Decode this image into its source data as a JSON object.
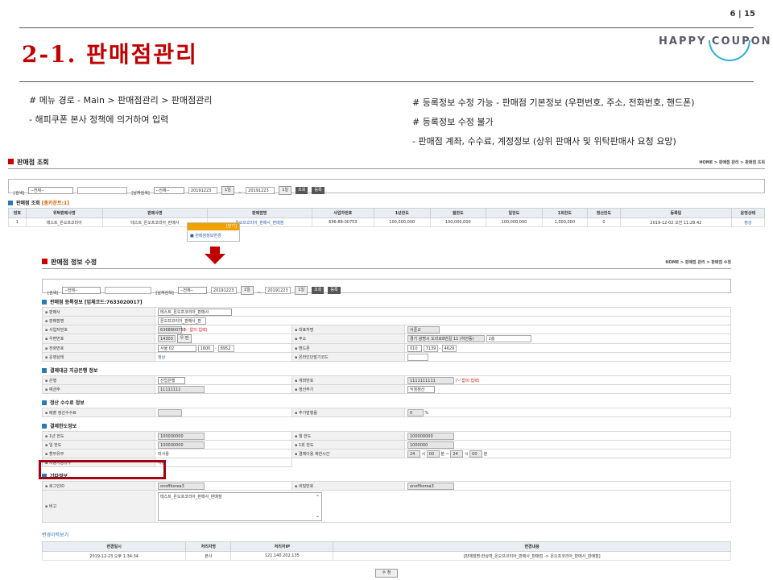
{
  "page_number": "6 | 15",
  "title": "2-1. 판매점관리",
  "logo": "HAPPY COUPON",
  "notes_left": [
    "# 메뉴 경로 - Main > 판매점관리 > 판매점관리",
    "- 해피쿠폰 본사 정책에 의거하여 입력"
  ],
  "notes_right": [
    "# 등록정보 수정 가능 - 판매점 기본정보 (우편번호, 주소, 전화번호, 핸드폰)",
    "# 등록정보 수정 불가",
    "- 판매점 계좌, 수수료, 계정정보 (상위 판매사 및 위탁판매사 요청 요망)"
  ],
  "list_screen": {
    "title": "판매점 조회",
    "breadcrumb": "HOME > 판매점 관리 > 판매점 조회",
    "search": {
      "label": "[검색]",
      "select": "--전체--",
      "date_label": "[날짜검색]",
      "date_select": "--전체--",
      "date_from": "20191223",
      "date_to": "20191223",
      "day": "1일",
      "sep": "~",
      "search_btn": "조회",
      "reg_btn": "등록"
    },
    "result_label": "판매점 조회",
    "result_count": "[총카운트:1]",
    "columns": [
      "번호",
      "위탁판매사명",
      "판매사명",
      "판매점명",
      "사업자번호",
      "1년한도",
      "월한도",
      "일한도",
      "1회한도",
      "정산한도",
      "등록일",
      "운영상태"
    ],
    "rows": [
      [
        "1",
        "테스트_온오프코리아",
        "테스트_온오프코리아_판매사",
        "온오프코리아_판매사_판매점",
        "636-88-00753",
        "100,000,000",
        "100,000,000",
        "100,000,000",
        "1,000,000",
        "0",
        "2019-12-02 오전 11:28:42",
        "정상"
      ]
    ],
    "popup_close": "[닫기]",
    "popup_item": "판매점정보변경"
  },
  "edit_screen": {
    "title": "판매점 정보 수정",
    "breadcrumb": "HOME > 판매점 관리 > 판매점 수정",
    "search": {
      "label": "[검색]",
      "select": "--전체--",
      "date_label": "[날짜검색]",
      "date_select": "--전체--",
      "date_from": "20191223",
      "date_to": "20191223",
      "day": "1일",
      "sep": "~",
      "search_btn": "조회",
      "reg_btn": "등록"
    },
    "reg_title": "판매점 등록정보 [업체코드:7633020017]",
    "reg": {
      "seller_label": "판매사",
      "seller_value": "테스트_온오프코리아_판매사",
      "store_label": "판매점명",
      "store_value": "온오프코리아_판매사_판",
      "biz_label": "사업자번호",
      "biz_value": "6368800753",
      "biz_note": "('-' 없이 입력)",
      "ceo_label": "대표자명",
      "ceo_value": "서준교",
      "zip_label": "우편번호",
      "zip_value": "14303",
      "zip_btn": "우 편",
      "addr_label": "주소",
      "addr_value": "경기 광명시 오리로8번길 11 (하안동)",
      "addr_detail": "2층",
      "tel_label": "전화번호",
      "tel_area": "서울 02",
      "tel_mid": "1600",
      "tel_end": "8952",
      "mobile_label": "핸드폰",
      "mobile_pre": "010",
      "mobile_mid": "7139",
      "mobile_end": "4629",
      "status_label": "운영상태",
      "status_value": "정상",
      "online_label": "온라인단말기코드",
      "online_value": ""
    },
    "bank_title": "결제대금 지급은행 정보",
    "bank": {
      "bank_label": "은행",
      "bank_value": "산업은행",
      "acct_label": "계좌번호",
      "acct_value": "1111111111",
      "acct_note": "('-' 없이 입력)",
      "holder_label": "예금주",
      "holder_value": "11111111",
      "cycle_label": "정산주기",
      "cycle_value": "익월정산"
    },
    "fee_title": "정산 수수료 정보",
    "fee": {
      "fee_label": "매출 정산수수료",
      "fee_value": "",
      "extra_label": "추가발행률",
      "extra_value": "0",
      "pct": "%"
    },
    "limit_title": "결제한도정보",
    "limit": {
      "year_label": "1년 한도",
      "year_value": "100000000",
      "month_label": "월 한도",
      "month_value": "100000000",
      "day_label": "일 한도",
      "day_value": "100000000",
      "once_label": "1회 한도",
      "once_value": "1000000",
      "unit_label": "할부유무",
      "unit_value": "미사용",
      "time_label": "결제이용 제한시간",
      "t1": "24",
      "t1u": "시",
      "t2": "00",
      "t2u": "분 ~",
      "t3": "24",
      "t3u": "시",
      "t4": "00",
      "t4u": "분",
      "auto_label": "자동사용유무",
      "auto_value": "사용"
    },
    "etc_title": "기타정보",
    "etc": {
      "login_label": "로그인ID",
      "login_value": "onoffkorea3",
      "pw_label": "비밀번호",
      "pw_value": "onoffkorea3",
      "memo_label": "비고",
      "memo_value": "테스트_온오프코리아_판매사_판매점"
    },
    "history_link": "변경이력보기",
    "history_columns": [
      "변경일시",
      "처리자명",
      "처리자IP",
      "변경내용"
    ],
    "history_rows": [
      [
        "2019-12-23 오후 1:34:34",
        "본사",
        "121.140.202.135",
        "[판매점명:한상혁_온오프코리아_판매사_판매점 -> 온오프코리아_판매사_판매점]"
      ]
    ],
    "save_btn": "수 정"
  }
}
